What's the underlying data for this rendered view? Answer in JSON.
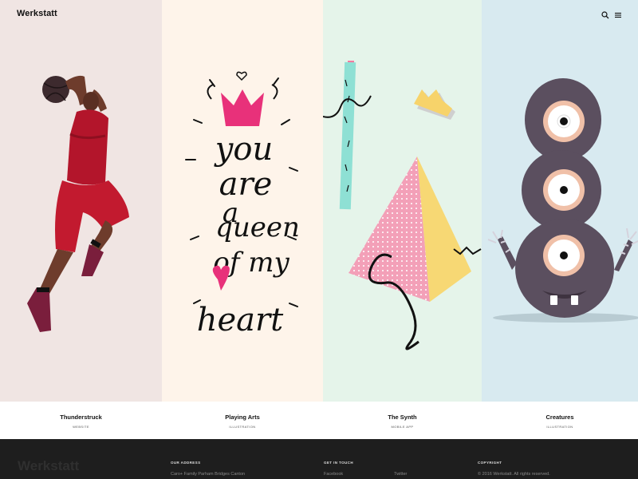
{
  "header": {
    "logo": "Werkstatt",
    "search_icon": "search-icon",
    "menu_icon": "menu-icon"
  },
  "panels": [
    {
      "title": "Thunderstruck",
      "category": "WEBSITE",
      "bg": "#f0e5e3"
    },
    {
      "title": "Playing Arts",
      "category": "ILLUSTRATION",
      "bg": "#fef4ea"
    },
    {
      "title": "The Synth",
      "category": "MOBILE APP",
      "bg": "#e5f4ea"
    },
    {
      "title": "Creatures",
      "category": "ILLUSTRATION",
      "bg": "#d8eaf0"
    }
  ],
  "artwork": {
    "lettering_1": "you",
    "lettering_2": "are",
    "lettering_3": "a",
    "lettering_4": "queen",
    "lettering_5": "of my",
    "lettering_6": "heart"
  },
  "footer": {
    "logo": "Werkstatt",
    "address_heading": "OUR ADDRESS",
    "address_text": "Caro+ Family Parham Bridges Canton",
    "contact_heading": "GET IN TOUCH",
    "contact_links": [
      "Facebook",
      "Twitter"
    ],
    "copyright_heading": "COPYRIGHT",
    "copyright_text": "© 2016 Werkstatt. All rights reserved."
  },
  "colors": {
    "accent_pink": "#e8317a",
    "footer_bg": "#1e1e1e",
    "monster_purple": "#5b4f5f"
  }
}
